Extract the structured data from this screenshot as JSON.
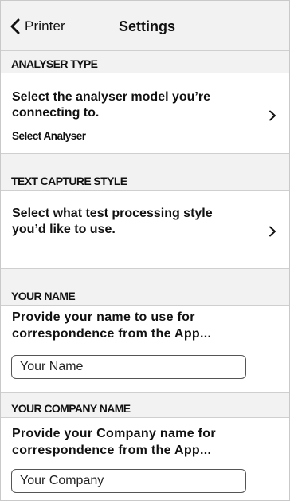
{
  "navbar": {
    "back_label": "Printer",
    "title": "Settings"
  },
  "icons": {
    "back": "chevron-left-icon",
    "row_disclosure": "chevron-right-icon"
  },
  "sections": {
    "analyser": {
      "header": "ANALYSER TYPE",
      "description": "Select the analyser model you’re connecting to.",
      "value": "Select Analyser"
    },
    "text_capture": {
      "header": "TEXT CAPTURE STYLE",
      "description": "Select what test processing style you’d like to use."
    },
    "your_name": {
      "header": "YOUR NAME",
      "description_line1": "Provide your name to use for",
      "description_line2": "correspondence from the App...",
      "placeholder": "Your Name"
    },
    "company_name": {
      "header": "YOUR COMPANY NAME",
      "description_line1": "Provide your Company name for",
      "description_line2": "correspondence from the App...",
      "placeholder": "Your Company"
    }
  }
}
